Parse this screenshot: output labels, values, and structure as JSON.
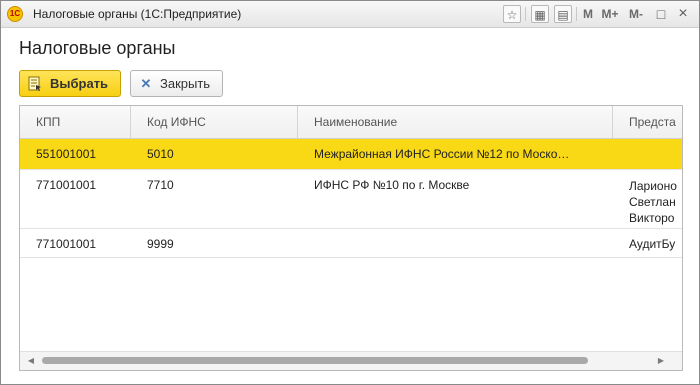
{
  "window": {
    "logo": "1С",
    "title": "Налоговые органы  (1С:Предприятие)",
    "controls": {
      "m": "M",
      "m_plus": "M+",
      "m_minus": "M-",
      "maximize": "□",
      "close": "×"
    },
    "icons": [
      "favorites-icon",
      "calculator-icon",
      "calendar-icon"
    ]
  },
  "page": {
    "title": "Налоговые органы"
  },
  "toolbar": {
    "select_label": "Выбрать",
    "close_label": "Закрыть"
  },
  "table": {
    "columns": [
      "КПП",
      "Код ИФНС",
      "Наименование",
      "Предста"
    ],
    "rows": [
      {
        "kpp": "551001001",
        "code": "5010",
        "name": "Межрайонная ИФНС России №12 по Моско…",
        "rep": "",
        "selected": true
      },
      {
        "kpp": "771001001",
        "code": "7710",
        "name": "ИФНС РФ №10 по г. Москве",
        "rep": "Ларионо\nСветлан\nВикторо",
        "selected": false
      },
      {
        "kpp": "771001001",
        "code": "9999",
        "name": "",
        "rep": "АудитБу",
        "selected": false
      }
    ]
  },
  "colors": {
    "selection": "#f9d916",
    "primary_button": "#f7cf12"
  }
}
